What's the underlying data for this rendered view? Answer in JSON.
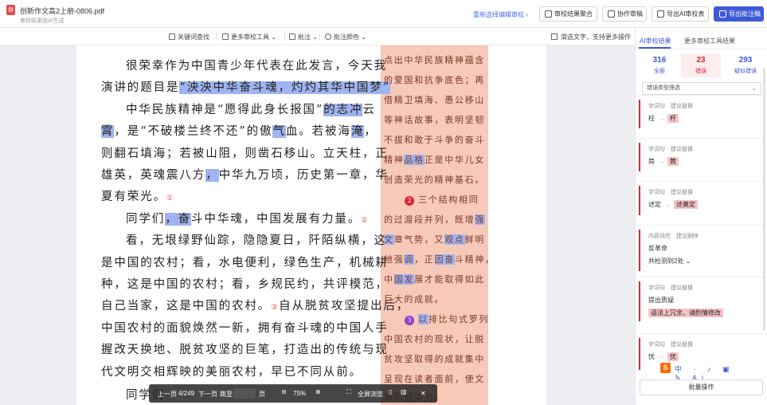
{
  "header": {
    "file_icon": "pdf-icon",
    "file_name": "创新作文高2上册-0806.pdf",
    "file_sub": "审校结果由AI生成",
    "reselect": "重新选择编辑审校 ›",
    "buttons": [
      {
        "label": "审校结果聚合",
        "icon": "merge-icon"
      },
      {
        "label": "协作审稿",
        "icon": "collab-icon"
      },
      {
        "label": "导出AI审校表",
        "icon": "export-icon"
      },
      {
        "label": "导出批注稿",
        "icon": "export-annot-icon"
      }
    ]
  },
  "toolbar": {
    "keyword_search": "关键词查找",
    "more_tools": "更多审校工具 ⌄",
    "annotate": "批注 ⌄",
    "annotate_color": "批注颜色 ⌄",
    "slide_hint": "滑选文字，支持更多操作"
  },
  "document": {
    "lines": [
      {
        "parts": [
          {
            "t": "很荣幸作为中国青少年代表在此发言，今天我"
          }
        ]
      },
      {
        "parts": [
          {
            "t": "演讲的题目是"
          },
          {
            "t": "“泱泱中华奋斗魂，灼灼其华中国梦”",
            "hl": true
          }
        ]
      },
      {
        "parts": [
          {
            "t": "中华民族精神是“愿得此身长报国”"
          },
          {
            "t": "的志冲",
            "hl": true
          },
          {
            "t": "云"
          }
        ]
      },
      {
        "parts": [
          {
            "t": "霄",
            "hl": true
          },
          {
            "t": "，是“不破楼兰终不还”的傲"
          },
          {
            "t": "气",
            "hl": true
          },
          {
            "t": "血"
          },
          {
            "t": "",
            "hl": true
          },
          {
            "t": "。若被海"
          },
          {
            "t": "淹",
            "hl": true
          },
          {
            "t": "，"
          }
        ]
      },
      {
        "parts": [
          {
            "t": "则翻石填海；若被山阻，则凿石移山。立天柱，正"
          }
        ]
      },
      {
        "parts": [
          {
            "t": "雄英，英魂震八方"
          },
          {
            "t": "，",
            "hl": true
          },
          {
            "t": "中华九万顷，历史第一章，华"
          }
        ]
      },
      {
        "parts": [
          {
            "t": "夏有荣光。"
          },
          {
            "t": "①",
            "mk": true
          }
        ]
      },
      {
        "parts": [
          {
            "t": "同学们"
          },
          {
            "t": "，奋",
            "hl": true
          },
          {
            "t": "斗中华魂，中国发展有力量。"
          },
          {
            "t": "②",
            "mk": true
          }
        ]
      },
      {
        "parts": [
          {
            "t": "看，无垠绿野仙踪，隐隐夏日，阡陌纵横，这"
          }
        ]
      },
      {
        "parts": [
          {
            "t": "是中国的农村；看，水电便利，绿色生产，机械耕"
          }
        ]
      },
      {
        "parts": [
          {
            "t": "种，这是中国的农村；看，乡规民约，共评模范，"
          }
        ]
      },
      {
        "parts": [
          {
            "t": "自己当家，这是中国的农村。"
          },
          {
            "t": "③",
            "mk": true
          },
          {
            "t": "自从脱贫攻坚提出后，"
          }
        ]
      },
      {
        "parts": [
          {
            "t": "中国农村的面貌焕然一新，拥有奋斗魂的中国人手"
          }
        ]
      },
      {
        "parts": [
          {
            "t": "握改天换地、脱贫攻坚的巨笔，打造出的传统与现"
          }
        ]
      },
      {
        "parts": [
          {
            "t": "代文明交相辉映的美丽农村，早已不同从前。"
          }
        ]
      },
      {
        "parts": [
          {
            "t": "同学们"
          }
        ]
      }
    ],
    "side_lines": [
      {
        "parts": [
          {
            "t": "点出中华民族精神蕴含"
          }
        ]
      },
      {
        "parts": [
          {
            "t": "的爱国和抗争底色；再"
          }
        ]
      },
      {
        "parts": [
          {
            "t": "借精卫填海、愚公移山"
          }
        ]
      },
      {
        "parts": [
          {
            "t": "等神话故事，表明坚韧"
          }
        ]
      },
      {
        "parts": [
          {
            "t": "不拔和敢于斗争的奋斗"
          }
        ]
      },
      {
        "parts": [
          {
            "t": "精神"
          },
          {
            "t": "品格",
            "hl": true
          },
          {
            "t": "正是中华儿女"
          }
        ]
      },
      {
        "parts": [
          {
            "t": "创造荣光的精神基石。"
          }
        ]
      },
      {
        "parts": [
          {
            "t": "2",
            "rc": true
          },
          {
            "t": " 三个结构相同"
          }
        ]
      },
      {
        "parts": [
          {
            "t": "的过渡段并列，既增"
          },
          {
            "t": "强",
            "hl": true
          }
        ]
      },
      {
        "parts": [
          {
            "t": "文",
            "hl": true
          },
          {
            "t": "章气势，又"
          },
          {
            "t": "观点",
            "hl": true
          },
          {
            "t": "鲜明"
          }
        ]
      },
      {
        "parts": [
          {
            "t": "地强"
          },
          {
            "t": "调",
            "hl": true
          },
          {
            "t": "，正"
          },
          {
            "t": "因奋",
            "hl": true
          },
          {
            "t": "斗精神，"
          }
        ]
      },
      {
        "parts": [
          {
            "t": "中"
          },
          {
            "t": "国发",
            "hl": true
          },
          {
            "t": "展才能取得如此"
          }
        ]
      },
      {
        "parts": [
          {
            "t": "巨大的成就。"
          }
        ]
      },
      {
        "parts": [
          {
            "t": "3",
            "rc": true,
            "v": true
          },
          {
            "t": " "
          },
          {
            "t": "以",
            "hl": true
          },
          {
            "t": "排比句式罗列"
          }
        ]
      },
      {
        "parts": [
          {
            "t": "中国农村的现状，让脱"
          }
        ]
      },
      {
        "parts": [
          {
            "t": "贫攻坚取得的成就集中"
          }
        ]
      },
      {
        "parts": [
          {
            "t": "呈现在读者面前，使文"
          }
        ]
      },
      {
        "parts": [
          {
            "t": "章"
          },
          {
            "t": "和感染力。"
          }
        ]
      }
    ]
  },
  "pager": {
    "prev": "上一页",
    "page": "4/249",
    "next": "下一页",
    "jump": "跳至",
    "page_unit": "页",
    "zoom": "75%",
    "fullscreen": "全屏浏览",
    "close": "✕"
  },
  "panel": {
    "tabs": [
      "AI审校结果",
      "更多审校工具结果"
    ],
    "stats": [
      {
        "num": "316",
        "label": "全部",
        "color": "#3d5ad6"
      },
      {
        "num": "23",
        "label": "错误",
        "color": "#e0252e"
      },
      {
        "num": "293",
        "label": "疑似错误",
        "color": "#3d5ad6"
      }
    ],
    "filter": "错误类型筛选",
    "cards": [
      {
        "type": "字词句",
        "action": "建议替换",
        "orig": "枉",
        "sugg": "杆"
      },
      {
        "type": "字词句",
        "action": "建议替换",
        "orig": "简",
        "sugg": "筒"
      },
      {
        "type": "字词句",
        "action": "建议替换",
        "orig": "述定",
        "sugg": "述奠定"
      },
      {
        "type": "内容风险",
        "action": "建议删除",
        "orig": "反革命",
        "sugg": "",
        "extra": "共检测到2处 ⌄"
      },
      {
        "type": "字词句",
        "action": "建议替换",
        "orig": "提出质疑",
        "sugg": "",
        "extra": "语法上冗余，请酌情修改"
      },
      {
        "type": "字词句",
        "action": "建议替换",
        "orig": "忧",
        "sugg": "优"
      }
    ],
    "ime_glyphs": "中 · ♪ ▣ ✎ Ai",
    "batch": "批量操作"
  }
}
